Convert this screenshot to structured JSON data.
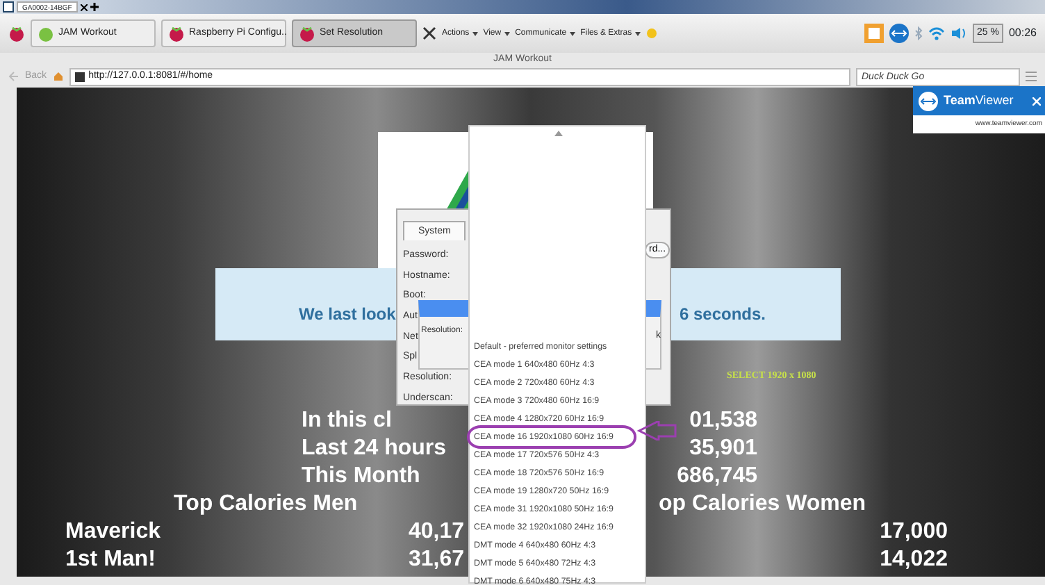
{
  "browser_tabs": [
    {
      "label": "GA0002-14BGF",
      "selected": true
    }
  ],
  "taskbar": {
    "tasks": [
      {
        "label": "JAM Workout",
        "selected": false
      },
      {
        "label": "Raspberry Pi Configu..",
        "selected": false
      },
      {
        "label": "Set Resolution",
        "selected": true
      }
    ],
    "menus": [
      "Actions",
      "View",
      "Communicate",
      "Files & Extras"
    ],
    "battery": "25 %",
    "clock": "00:26"
  },
  "window": {
    "title": "JAM Workout"
  },
  "navbar": {
    "back": "Back",
    "url": "http://127.0.0.1:8081/#/home",
    "search_placeholder": "Duck Duck Go"
  },
  "teamviewer": {
    "title": "**Team**Viewer",
    "link": "www.teamviewer.com"
  },
  "banner": {
    "left": "We last look",
    "right": "6 seconds."
  },
  "hint": "SELECT 1920 x 1080",
  "stats": [
    {
      "label": "In this cl",
      "value": "01,538"
    },
    {
      "label": "Last 24 hours",
      "value": "35,901"
    },
    {
      "label": "This Month",
      "value": "686,745"
    }
  ],
  "leaderboard": {
    "men_title": "Top Calories Men",
    "women_title": "op Calories Women",
    "rows": [
      {
        "name": "Maverick",
        "men": "40,17",
        "women": "17,000"
      },
      {
        "name": "1st Man!",
        "men": "31,67",
        "women": "14,022"
      }
    ]
  },
  "config_dialog": {
    "tabs": [
      {
        "label": "System",
        "selected": true
      }
    ],
    "labels": [
      "Password:",
      "Hostname:",
      "Boot:",
      "Aut",
      "Net",
      "Spl",
      "Resolution:",
      "Underscan:"
    ],
    "button": "rd...",
    "side_text": "k",
    "sub_dialog_label": "Resolution:"
  },
  "resolution_list": [
    {
      "label": "Default - preferred monitor settings",
      "selected": false
    },
    {
      "label": "CEA mode 1 640x480 60Hz 4:3",
      "selected": false
    },
    {
      "label": "CEA mode 2 720x480 60Hz 4:3",
      "selected": false
    },
    {
      "label": "CEA mode 3 720x480 60Hz 16:9",
      "selected": false
    },
    {
      "label": "CEA mode 4 1280x720 60Hz 16:9",
      "selected": false
    },
    {
      "label": "CEA mode 16 1920x1080 60Hz 16:9",
      "selected": true
    },
    {
      "label": "CEA mode 17 720x576 50Hz 4:3",
      "selected": false
    },
    {
      "label": "CEA mode 18 720x576 50Hz 16:9",
      "selected": false
    },
    {
      "label": "CEA mode 19 1280x720 50Hz 16:9",
      "selected": false
    },
    {
      "label": "CEA mode 31 1920x1080 50Hz 16:9",
      "selected": false
    },
    {
      "label": "CEA mode 32 1920x1080 24Hz 16:9",
      "selected": false
    },
    {
      "label": "DMT mode 4 640x480 60Hz 4:3",
      "selected": false
    },
    {
      "label": "DMT mode 5 640x480 72Hz 4:3",
      "selected": false
    },
    {
      "label": "DMT mode 6 640x480 75Hz 4:3",
      "selected": false
    }
  ]
}
